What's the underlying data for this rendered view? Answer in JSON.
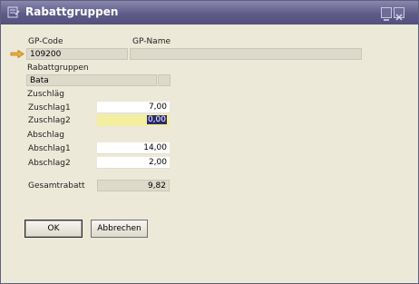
{
  "window": {
    "title": "Rabattgruppen"
  },
  "header": {
    "gp_code_label": "GP-Code",
    "gp_name_label": "GP-Name",
    "gp_code_value": "109200",
    "gp_name_value": ""
  },
  "rabattgruppen": {
    "label": "Rabattgruppen",
    "value": "Bata"
  },
  "zuschlag": {
    "section_label": "Zuschläg",
    "rows": [
      {
        "label": "Zuschlag1",
        "value": "7,00"
      },
      {
        "label": "Zuschlag2",
        "value": "0,00"
      }
    ]
  },
  "abschlag": {
    "section_label": "Abschlag",
    "rows": [
      {
        "label": "Abschlag1",
        "value": "14,00"
      },
      {
        "label": "Abschlag2",
        "value": "2,00"
      }
    ]
  },
  "gesamtrabatt": {
    "label": "Gesamtrabatt",
    "value": "9,82"
  },
  "buttons": {
    "ok": "OK",
    "cancel": "Abbrechen"
  },
  "icons": {
    "title": "form-icon",
    "row_indicator": "arrow-right-icon",
    "minimize": "minimize-icon",
    "close": "close-icon"
  },
  "colors": {
    "title_bar": "#5e5b89",
    "highlight_field": "#f3eea0",
    "window_bg": "#ece9d8"
  }
}
